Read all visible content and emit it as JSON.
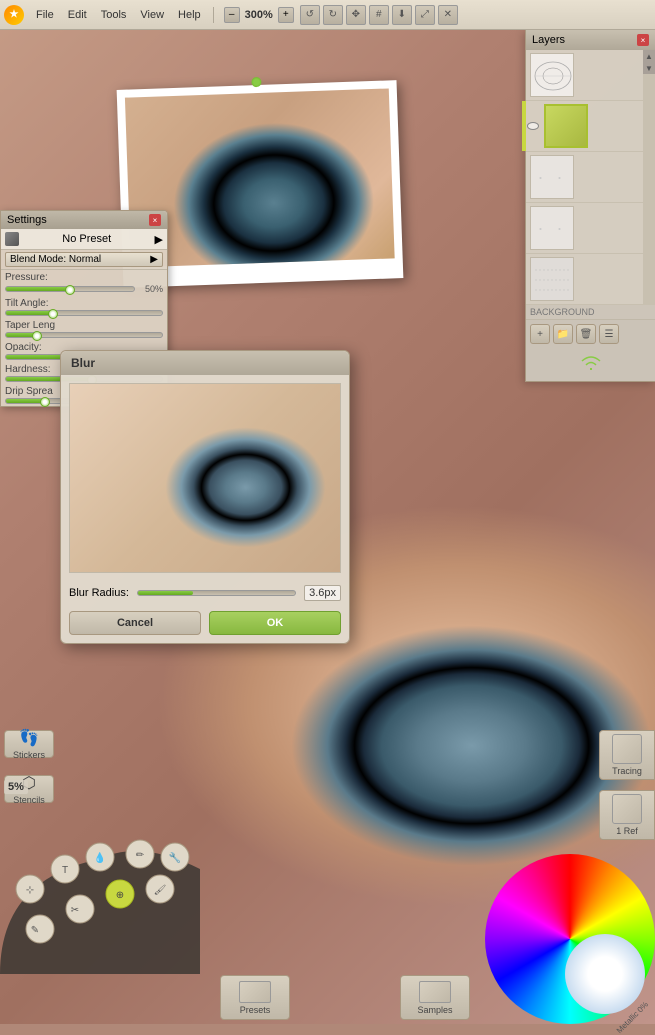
{
  "menubar": {
    "logo": "★",
    "items": [
      {
        "label": "File"
      },
      {
        "label": "Edit"
      },
      {
        "label": "Tools"
      },
      {
        "label": "View"
      },
      {
        "label": "Help"
      }
    ],
    "zoom": "300%",
    "zoom_minus": "–",
    "zoom_plus": "+"
  },
  "settings": {
    "title": "Settings",
    "close": "×",
    "preset": "No Preset",
    "blend_mode": "Blend Mode: Normal",
    "pressure_label": "Pressure:",
    "pressure_value": "50%",
    "tilt_label": "Tilt Angle:",
    "taper_label": "Taper Leng",
    "opacity_label": "Opacity:",
    "hardness_label": "Hardness:",
    "drip_label": "Drip Sprea"
  },
  "blur_dialog": {
    "title": "Blur",
    "radius_label": "Blur Radius:",
    "radius_value": "3.6px",
    "cancel_label": "Cancel",
    "ok_label": "OK"
  },
  "layers": {
    "title": "Layers",
    "close": "×"
  },
  "toolbox": {
    "stickers_label": "Stickers",
    "stencils_label": "Stencils",
    "zoom_label": "5%",
    "presets_label": "Presets",
    "samples_label": "Samples"
  },
  "sidebar_right": {
    "tracing_label": "Tracing",
    "ref_label": "1 Ref",
    "metallic_label": "Metallic 0%"
  }
}
